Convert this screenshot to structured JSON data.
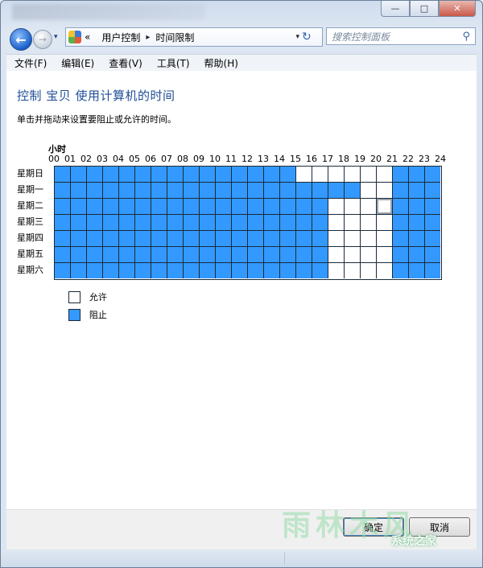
{
  "window": {
    "caption_buttons": {
      "minimize": "—",
      "maximize": "□",
      "close": "✕"
    }
  },
  "nav": {
    "back_icon": "←",
    "forward_icon": "→",
    "history_dropdown_icon": "▾",
    "breadcrumb": {
      "prefix": "«",
      "items": [
        "用户控制",
        "时间限制"
      ],
      "separator": "▸",
      "dropdown_icon": "▾"
    },
    "refresh_icon": "↻",
    "search_placeholder": "搜索控制面板",
    "search_icon": "⚲"
  },
  "menu": {
    "items": [
      "文件(F)",
      "编辑(E)",
      "查看(V)",
      "工具(T)",
      "帮助(H)"
    ]
  },
  "content": {
    "heading": "控制 宝贝 使用计算机的时间",
    "instruction": "单击并拖动来设置要阻止或允许的时间。",
    "hours_label": "小时",
    "hours": [
      "00",
      "01",
      "02",
      "03",
      "04",
      "05",
      "06",
      "07",
      "08",
      "09",
      "10",
      "11",
      "12",
      "13",
      "14",
      "15",
      "16",
      "17",
      "18",
      "19",
      "20",
      "21",
      "22",
      "23",
      "24"
    ],
    "days": [
      "星期日",
      "星期一",
      "星期二",
      "星期三",
      "星期四",
      "星期五",
      "星期六"
    ],
    "schedule": [
      "111111111111111000111",
      "1111111111111111111001111",
      "111111111111111111110000111",
      "111111111111111111110000111",
      "111111111111111111110000111",
      "111111111111111111110000111",
      "111111111111111111110000111"
    ],
    "blocked_hours_by_day": [
      {
        "day": "星期日",
        "blocked": [
          0,
          1,
          2,
          3,
          4,
          5,
          6,
          7,
          8,
          9,
          10,
          11,
          12,
          13,
          14,
          21,
          22,
          23
        ]
      },
      {
        "day": "星期一",
        "blocked": [
          0,
          1,
          2,
          3,
          4,
          5,
          6,
          7,
          8,
          9,
          10,
          11,
          12,
          13,
          14,
          15,
          16,
          17,
          18,
          21,
          22,
          23
        ]
      },
      {
        "day": "星期二",
        "blocked": [
          0,
          1,
          2,
          3,
          4,
          5,
          6,
          7,
          8,
          9,
          10,
          11,
          12,
          13,
          14,
          15,
          16,
          21,
          22,
          23
        ]
      },
      {
        "day": "星期三",
        "blocked": [
          0,
          1,
          2,
          3,
          4,
          5,
          6,
          7,
          8,
          9,
          10,
          11,
          12,
          13,
          14,
          15,
          16,
          21,
          22,
          23
        ]
      },
      {
        "day": "星期四",
        "blocked": [
          0,
          1,
          2,
          3,
          4,
          5,
          6,
          7,
          8,
          9,
          10,
          11,
          12,
          13,
          14,
          15,
          16,
          21,
          22,
          23
        ]
      },
      {
        "day": "星期五",
        "blocked": [
          0,
          1,
          2,
          3,
          4,
          5,
          6,
          7,
          8,
          9,
          10,
          11,
          12,
          13,
          14,
          15,
          16,
          21,
          22,
          23
        ]
      },
      {
        "day": "星期六",
        "blocked": [
          0,
          1,
          2,
          3,
          4,
          5,
          6,
          7,
          8,
          9,
          10,
          11,
          12,
          13,
          14,
          15,
          16,
          21,
          22,
          23
        ]
      }
    ],
    "legend": {
      "allowed": "允许",
      "blocked": "阻止"
    }
  },
  "footer": {
    "ok_label": "确定",
    "cancel_label": "取消"
  },
  "watermark": {
    "text": "雨林木风",
    "text2": "系统之家"
  },
  "colors": {
    "blocked": "#3399ff",
    "allowed": "#ffffff",
    "heading": "#1f4f96"
  }
}
